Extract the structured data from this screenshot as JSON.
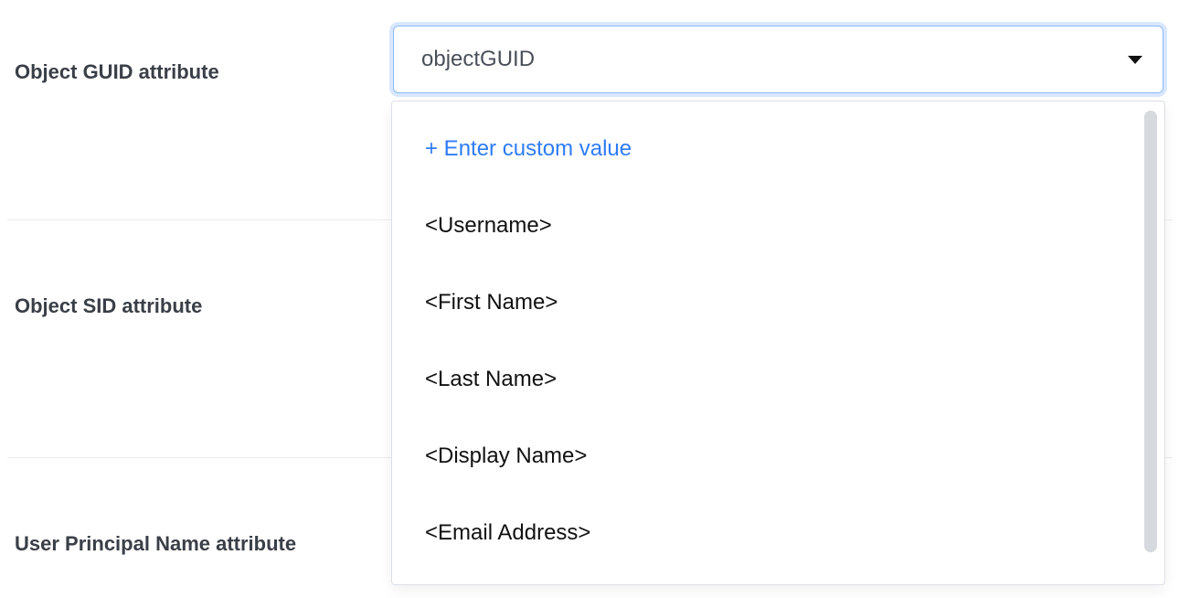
{
  "fields": {
    "object_guid": {
      "label": "Object GUID attribute",
      "value": "objectGUID"
    },
    "object_sid": {
      "label": "Object SID attribute"
    },
    "user_principal": {
      "label": "User Principal Name attribute"
    }
  },
  "dropdown": {
    "custom_label": "+ Enter custom value",
    "options": [
      "<Username>",
      "<First Name>",
      "<Last Name>",
      "<Display Name>",
      "<Email Address>"
    ]
  }
}
